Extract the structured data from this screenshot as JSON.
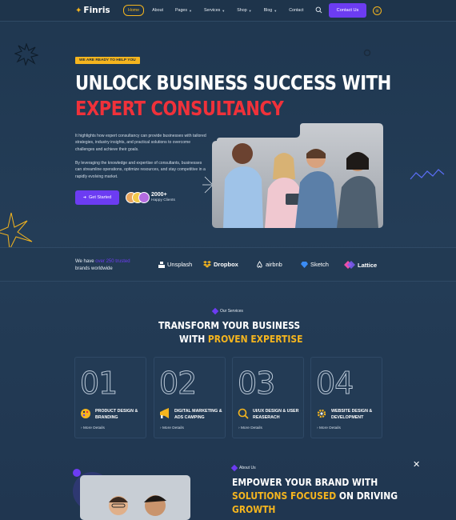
{
  "nav": {
    "logo": "Finris",
    "links": [
      {
        "label": "Home",
        "active": true,
        "dropdown": false
      },
      {
        "label": "About",
        "active": false,
        "dropdown": false
      },
      {
        "label": "Pages",
        "active": false,
        "dropdown": true
      },
      {
        "label": "Services",
        "active": false,
        "dropdown": true
      },
      {
        "label": "Shop",
        "active": false,
        "dropdown": true
      },
      {
        "label": "Blog",
        "active": false,
        "dropdown": true
      },
      {
        "label": "Contact",
        "active": false,
        "dropdown": false
      }
    ],
    "contact_label": "Contact Us",
    "search_icon": "search-icon",
    "grid_icon": "grid-icon"
  },
  "hero": {
    "tagline": "WE ARE READY TO HELP YOU",
    "title_line1": "UNLOCK BUSINESS SUCCESS WITH",
    "title_line2": "EXPERT CONSULTANCY",
    "paragraph1": "It highlights how expert consultancy can provide businesses with tailored strategies, industry insights, and practical solutions to overcome challenges and achieve their goals.",
    "paragraph2": "By leveraging the knowledge and expertise of consultants, businesses can streamline operations, optimize resources, and stay competitive in a rapidly evolving market.",
    "cta_label": "Get Started",
    "clients_count": "2000+",
    "clients_label": "Happy Clients"
  },
  "brands": {
    "text_before": "We have ",
    "text_highlight": "over 250 trusted",
    "text_after": "brands worldwide",
    "items": [
      "Unsplash",
      "Dropbox",
      "airbnb",
      "Sketch",
      "Lattice"
    ]
  },
  "services": {
    "label": "Our Services",
    "title_line1": "TRANSFORM YOUR BUSINESS",
    "title_line2_prefix": "WITH ",
    "title_line2_highlight": "PROVEN EXPERTISE",
    "cards": [
      {
        "num": "01",
        "title": "PRODUCT DESIGN & BRANDING",
        "more": "More Details"
      },
      {
        "num": "02",
        "title": "DIGITAL MARKETING & ADS CAMPING",
        "more": "More Details"
      },
      {
        "num": "03",
        "title": "UI/UX DESIGN & USER REASERACH",
        "more": "More Details"
      },
      {
        "num": "04",
        "title": "WEBSITE DESIGN & DEVELOPMENT",
        "more": "More Details"
      }
    ]
  },
  "about": {
    "label": "About Us",
    "title_line1": "EMPOWER YOUR BRAND WITH",
    "title_line2_highlight": "SOLUTIONS FOCUSED",
    "title_line2_rest": " ON DRIVING",
    "title_line3": "GROWTH",
    "close_symbol": "✕"
  },
  "colors": {
    "accent_purple": "#6c3cf2",
    "accent_yellow": "#f5b51e",
    "accent_red": "#f0313a",
    "background": "#223a52"
  }
}
